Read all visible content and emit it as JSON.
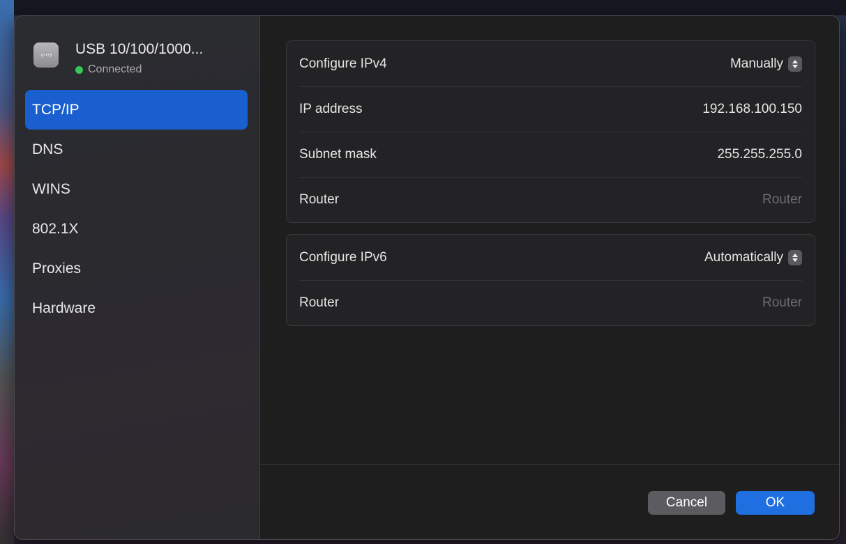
{
  "device": {
    "name": "USB 10/100/1000...",
    "status": "Connected",
    "icon": "ethernet-icon",
    "icon_glyph": "‹···›"
  },
  "sidebar": {
    "items": [
      {
        "label": "TCP/IP",
        "selected": true
      },
      {
        "label": "DNS",
        "selected": false
      },
      {
        "label": "WINS",
        "selected": false
      },
      {
        "label": "802.1X",
        "selected": false
      },
      {
        "label": "Proxies",
        "selected": false
      },
      {
        "label": "Hardware",
        "selected": false
      }
    ]
  },
  "ipv4": {
    "configure_label": "Configure IPv4",
    "configure_value": "Manually",
    "ip_label": "IP address",
    "ip_value": "192.168.100.150",
    "subnet_label": "Subnet mask",
    "subnet_value": "255.255.255.0",
    "router_label": "Router",
    "router_placeholder": "Router"
  },
  "ipv6": {
    "configure_label": "Configure IPv6",
    "configure_value": "Automatically",
    "router_label": "Router",
    "router_placeholder": "Router"
  },
  "footer": {
    "cancel_label": "Cancel",
    "ok_label": "OK"
  },
  "colors": {
    "accent": "#1a5fd0",
    "ok_button": "#1f6fe0",
    "status_green": "#34c759"
  }
}
